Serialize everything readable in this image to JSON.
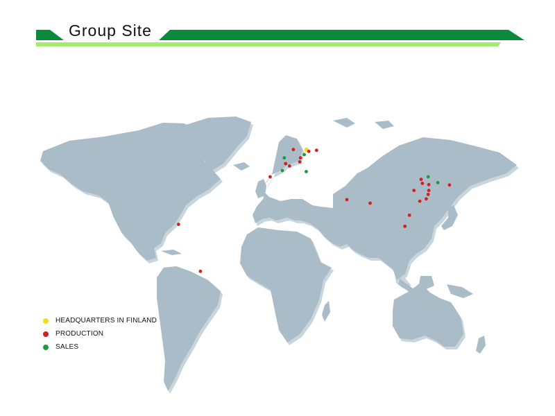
{
  "header": {
    "title": "Group Site",
    "colors": {
      "dark_green": "#0a8a3a",
      "light_green": "#a6ea72"
    }
  },
  "map": {
    "ocean_color": "#ffffff",
    "land_color": "#a9bcc8",
    "land_shadow_color": "#c9d5dd"
  },
  "legend": [
    {
      "key": "hq",
      "label": "HEADQUARTERS IN FINLAND",
      "color": "#f1dc1f"
    },
    {
      "key": "production",
      "label": "PRODUCTION",
      "color": "#d3201f"
    },
    {
      "key": "sales",
      "label": "SALES",
      "color": "#1f9a3e"
    }
  ],
  "sites": [
    {
      "type": "hq",
      "lon": 25.7,
      "lat": 62.2
    },
    {
      "type": "production",
      "lon": 15.5,
      "lat": 62.4
    },
    {
      "type": "production",
      "lon": 27.5,
      "lat": 61.0
    },
    {
      "type": "production",
      "lon": 33.5,
      "lat": 61.8
    },
    {
      "type": "production",
      "lon": 21.0,
      "lat": 56.0
    },
    {
      "type": "production",
      "lon": 20.5,
      "lat": 53.0
    },
    {
      "type": "production",
      "lon": 9.5,
      "lat": 51.6
    },
    {
      "type": "production",
      "lon": 12.5,
      "lat": 49.8
    },
    {
      "type": "production",
      "lon": -2.5,
      "lat": 41.5
    },
    {
      "type": "production",
      "lon": 57.0,
      "lat": 24.0
    },
    {
      "type": "production",
      "lon": 75.0,
      "lat": 21.3
    },
    {
      "type": "production",
      "lon": 114.5,
      "lat": 39.5
    },
    {
      "type": "production",
      "lon": 115.5,
      "lat": 36.5
    },
    {
      "type": "production",
      "lon": 120.5,
      "lat": 35.5
    },
    {
      "type": "production",
      "lon": 109.0,
      "lat": 31.0
    },
    {
      "type": "production",
      "lon": 120.5,
      "lat": 31.0
    },
    {
      "type": "production",
      "lon": 120.0,
      "lat": 28.0
    },
    {
      "type": "production",
      "lon": 118.5,
      "lat": 24.5
    },
    {
      "type": "production",
      "lon": 113.5,
      "lat": 22.8
    },
    {
      "type": "production",
      "lon": 136.5,
      "lat": 35.2
    },
    {
      "type": "production",
      "lon": 105.5,
      "lat": 12.0
    },
    {
      "type": "production",
      "lon": 102.0,
      "lat": 3.5
    },
    {
      "type": "production",
      "lon": -73.5,
      "lat": 5.0
    },
    {
      "type": "production",
      "lon": -56.5,
      "lat": -31.0
    },
    {
      "type": "sales",
      "lon": 24.0,
      "lat": 58.5
    },
    {
      "type": "sales",
      "lon": 8.5,
      "lat": 56.0
    },
    {
      "type": "sales",
      "lon": 7.0,
      "lat": 46.3
    },
    {
      "type": "sales",
      "lon": 25.5,
      "lat": 45.5
    },
    {
      "type": "sales",
      "lon": 120.0,
      "lat": 41.5
    },
    {
      "type": "sales",
      "lon": 127.5,
      "lat": 37.0
    }
  ]
}
